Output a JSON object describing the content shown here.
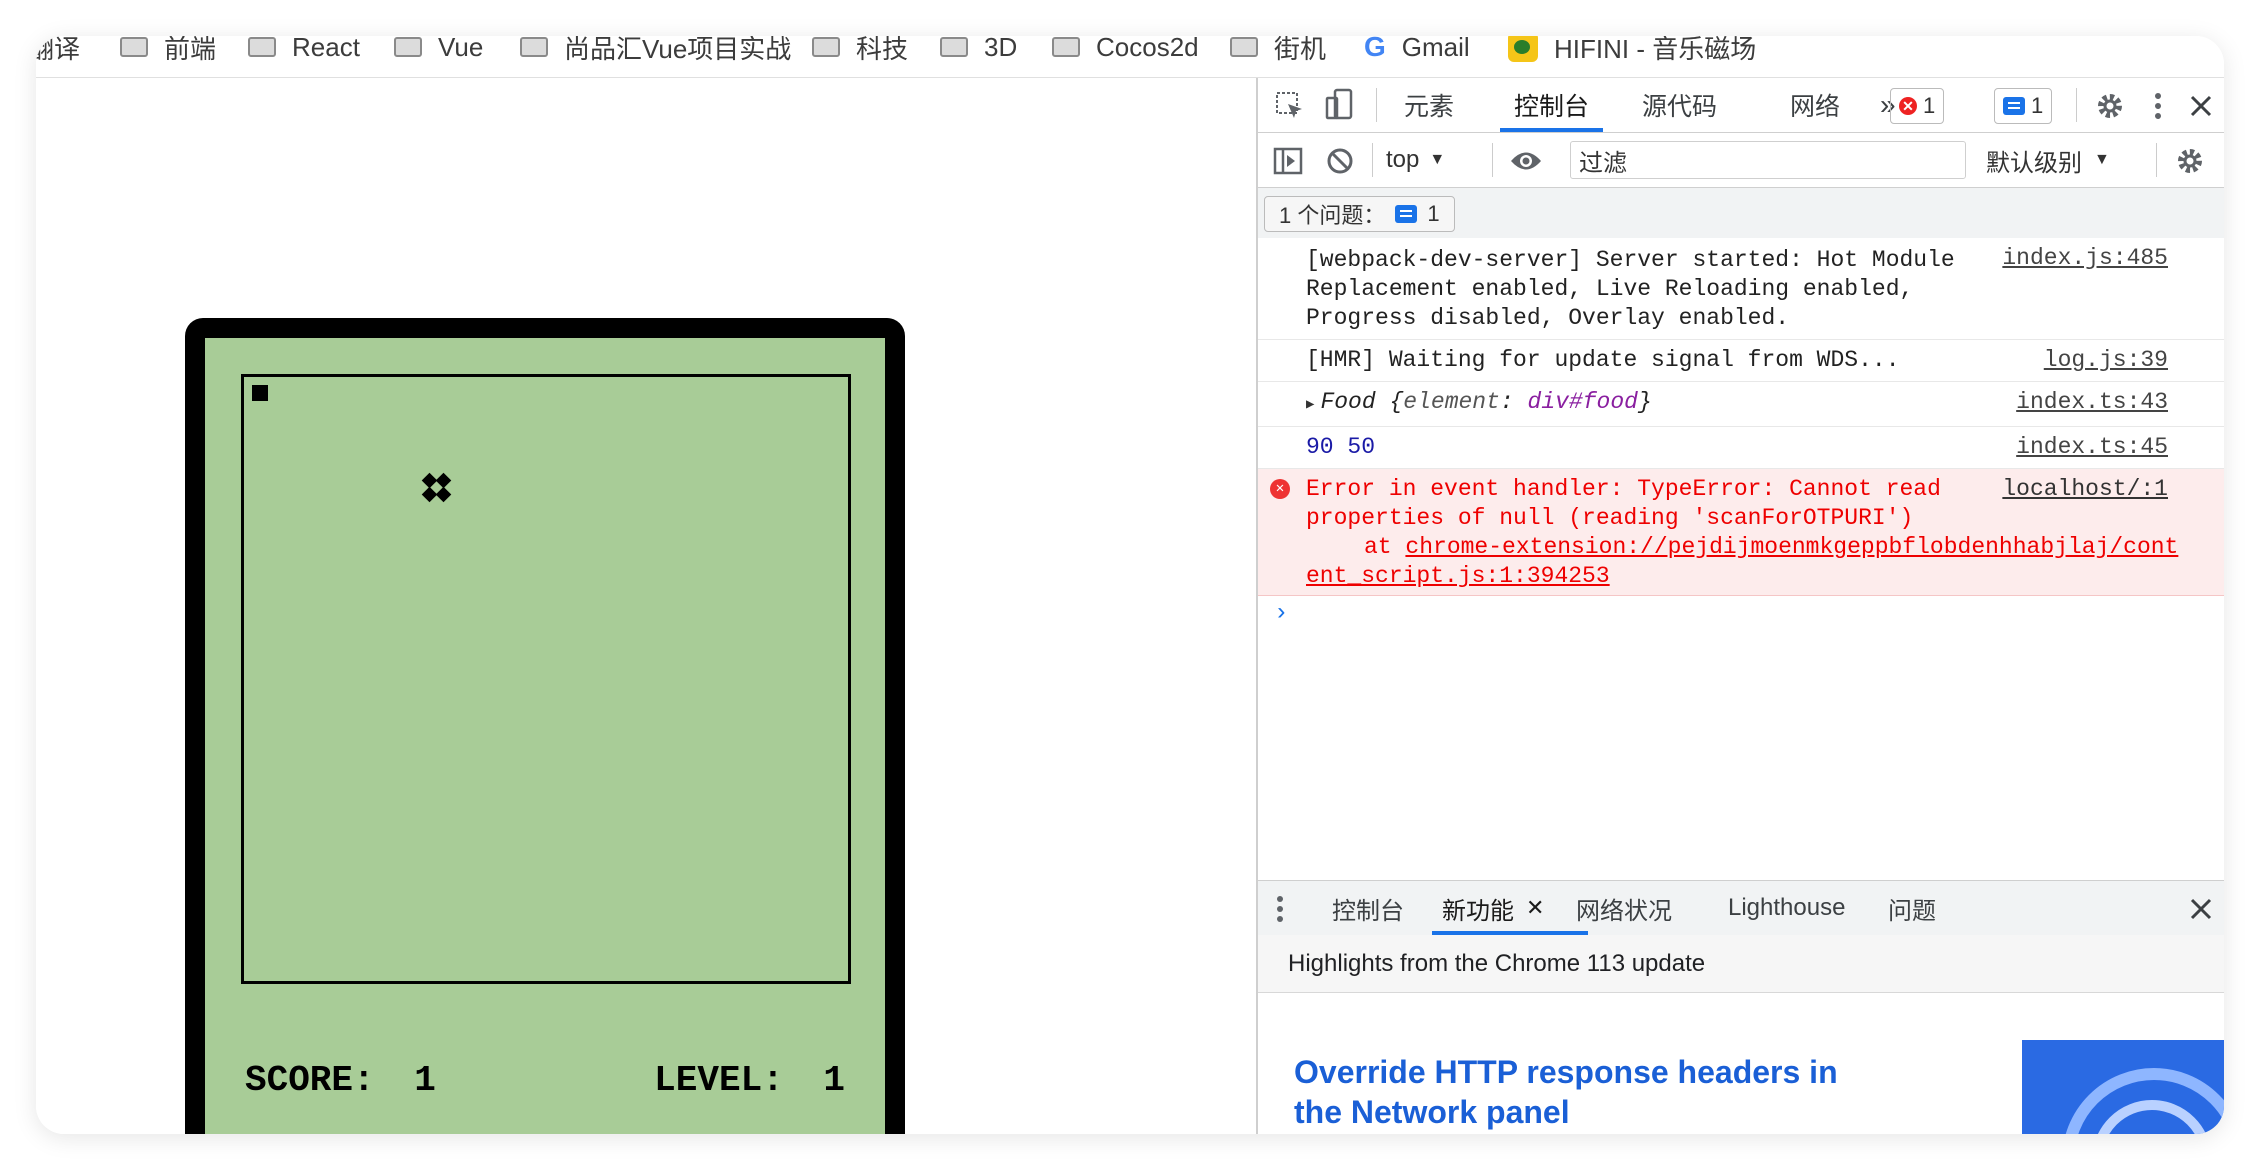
{
  "bookmarks": [
    {
      "label": "翻译",
      "type": "folder"
    },
    {
      "label": "前端",
      "type": "folder"
    },
    {
      "label": "React",
      "type": "folder"
    },
    {
      "label": "Vue",
      "type": "folder"
    },
    {
      "label": "尚品汇Vue项目实战",
      "type": "folder"
    },
    {
      "label": "科技",
      "type": "folder"
    },
    {
      "label": "3D",
      "type": "folder"
    },
    {
      "label": "Cocos2d",
      "type": "folder"
    },
    {
      "label": "街机",
      "type": "folder"
    },
    {
      "label": "Gmail",
      "type": "google"
    },
    {
      "label": "HIFINI - 音乐磁场",
      "type": "hifini"
    }
  ],
  "game": {
    "score_label": "SCORE:",
    "score_value": "1",
    "level_label": "LEVEL:",
    "level_value": "1"
  },
  "devtools": {
    "tabs": [
      "元素",
      "控制台",
      "源代码",
      "网络"
    ],
    "more": "»",
    "error_count": "1",
    "message_count": "1",
    "context": "top",
    "filter_placeholder": "过滤",
    "log_level": "默认级别",
    "issues_label": "1 个问题：",
    "issues_count": "1",
    "logs": {
      "l1_text": "[webpack-dev-server] Server started: Hot Module Replacement enabled, Live Reloading enabled, Progress disabled, Overlay enabled.",
      "l1_src": "index.js:485",
      "l2_text": "[HMR] Waiting for update signal from WDS...",
      "l2_src": "log.js:39",
      "l3_name": "Food",
      "l3_key": "element",
      "l3_val": "div#food",
      "l3_src": "index.ts:43",
      "l4_text": "90 50",
      "l4_src": "index.ts:45",
      "l5_text": "Error in event handler: TypeError: Cannot read properties of null (reading 'scanForOTPURI')",
      "l5_at": "at",
      "l5_link": "chrome-extension://pejdijmoenmkgeppbflobdenhhabjlaj/content_script.js:1:394253",
      "l5_src": "localhost/:1"
    },
    "drawer_tabs": [
      "控制台",
      "新功能",
      "网络状况",
      "Lighthouse",
      "问题"
    ],
    "whatsnew_header": "Highlights from the Chrome 113 update",
    "feature_title": "Override HTTP response headers in the Network panel"
  },
  "colors": {
    "game_bg": "#a8cc97",
    "accent": "#1a73e8",
    "error": "#e00000"
  }
}
